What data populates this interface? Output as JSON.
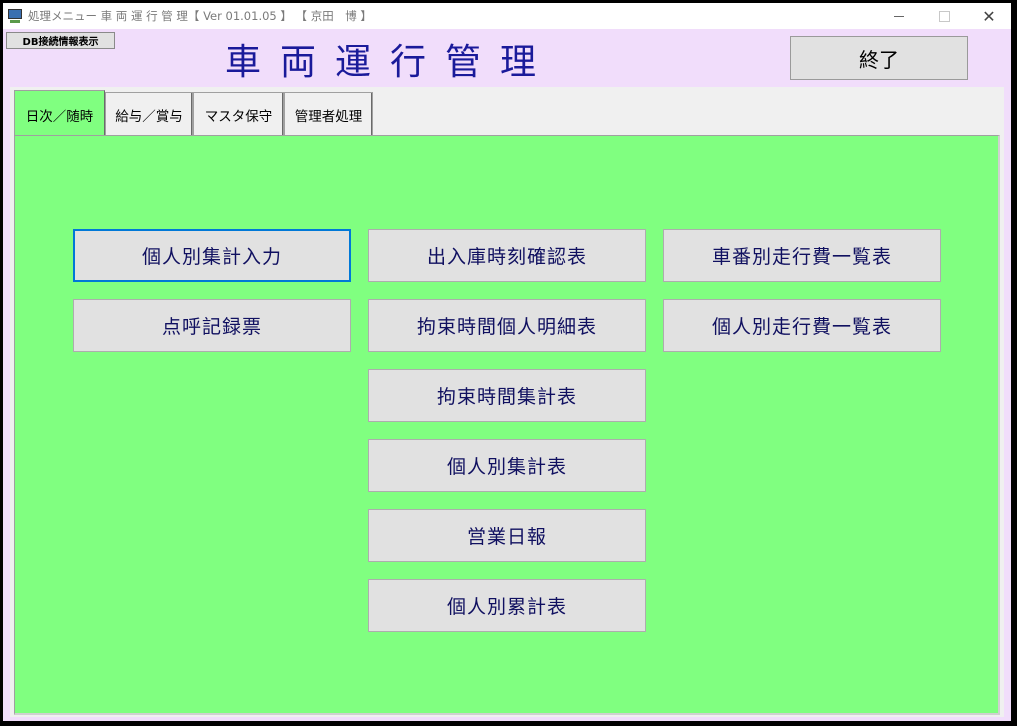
{
  "window": {
    "title": "処理メニュー 車 両 運 行 管 理【 Ver 01.01.05 】 【 京田　博 】",
    "close_glyph": "✕"
  },
  "header": {
    "db_button": "DB接続情報表示",
    "title": "車両運行管理",
    "exit_button": "終了"
  },
  "tabs": [
    {
      "label": "日次／随時",
      "active": true
    },
    {
      "label": "給与／賞与",
      "active": false
    },
    {
      "label": "マスタ保守",
      "active": false
    },
    {
      "label": "管理者処理",
      "active": false
    }
  ],
  "menu_buttons": [
    "個人別集計入力",
    "出入庫時刻確認表",
    "車番別走行費一覧表",
    "点呼記録票",
    "拘束時間個人明細表",
    "個人別走行費一覧表",
    "拘束時間集計表",
    "個人別集計表",
    "営業日報",
    "個人別累計表"
  ],
  "colors": {
    "panel_bg": "#80ff80",
    "header_bg": "#f1ddfb",
    "title_color": "#1a1a9a",
    "button_text": "#101060",
    "focus_border": "#0078d7"
  }
}
